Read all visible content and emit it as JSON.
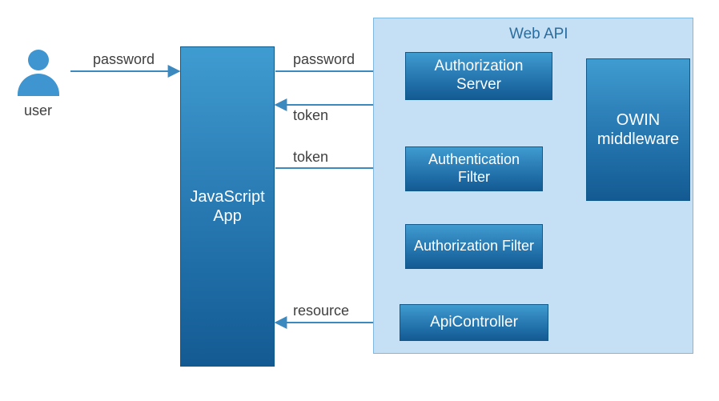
{
  "diagram": {
    "user_label": "user",
    "js_app": "JavaScript App",
    "webapi_title": "Web API",
    "auth_server": "Authorization Server",
    "authn_filter": "Authentication Filter",
    "authz_filter": "Authorization Filter",
    "api_controller": "ApiController",
    "owin": "OWIN middleware",
    "edge_password_1": "password",
    "edge_password_2": "password",
    "edge_token_1": "token",
    "edge_token_2": "token",
    "edge_resource": "resource"
  },
  "colors": {
    "line": "#3b89bf",
    "container_bg": "#c5e0f5",
    "container_border": "#7fb7e0",
    "box_text": "#ffffff"
  },
  "chart_data": {
    "type": "diagram",
    "title": "Web API authentication flow",
    "nodes": [
      {
        "id": "user",
        "label": "user",
        "type": "actor"
      },
      {
        "id": "jsapp",
        "label": "JavaScript App",
        "type": "component"
      },
      {
        "id": "webapi",
        "label": "Web API",
        "type": "container",
        "children": [
          "authserver",
          "authnfilter",
          "authzfilter",
          "apicontroller"
        ]
      },
      {
        "id": "authserver",
        "label": "Authorization Server",
        "type": "component"
      },
      {
        "id": "authnfilter",
        "label": "Authentication Filter",
        "type": "component"
      },
      {
        "id": "authzfilter",
        "label": "Authorization Filter",
        "type": "component"
      },
      {
        "id": "apicontroller",
        "label": "ApiController",
        "type": "component"
      },
      {
        "id": "owin",
        "label": "OWIN middleware",
        "type": "component"
      }
    ],
    "edges": [
      {
        "from": "user",
        "to": "jsapp",
        "label": "password",
        "dir": "forward"
      },
      {
        "from": "jsapp",
        "to": "authserver",
        "label": "password",
        "dir": "forward"
      },
      {
        "from": "authserver",
        "to": "jsapp",
        "label": "token",
        "dir": "forward"
      },
      {
        "from": "jsapp",
        "to": "authnfilter",
        "label": "token",
        "dir": "forward"
      },
      {
        "from": "authserver",
        "to": "owin",
        "label": "",
        "dir": "both"
      },
      {
        "from": "authnfilter",
        "to": "owin",
        "label": "",
        "dir": "both"
      },
      {
        "from": "authnfilter",
        "to": "authzfilter",
        "label": "",
        "dir": "forward"
      },
      {
        "from": "authzfilter",
        "to": "apicontroller",
        "label": "",
        "dir": "forward"
      },
      {
        "from": "apicontroller",
        "to": "jsapp",
        "label": "resource",
        "dir": "forward"
      }
    ]
  }
}
